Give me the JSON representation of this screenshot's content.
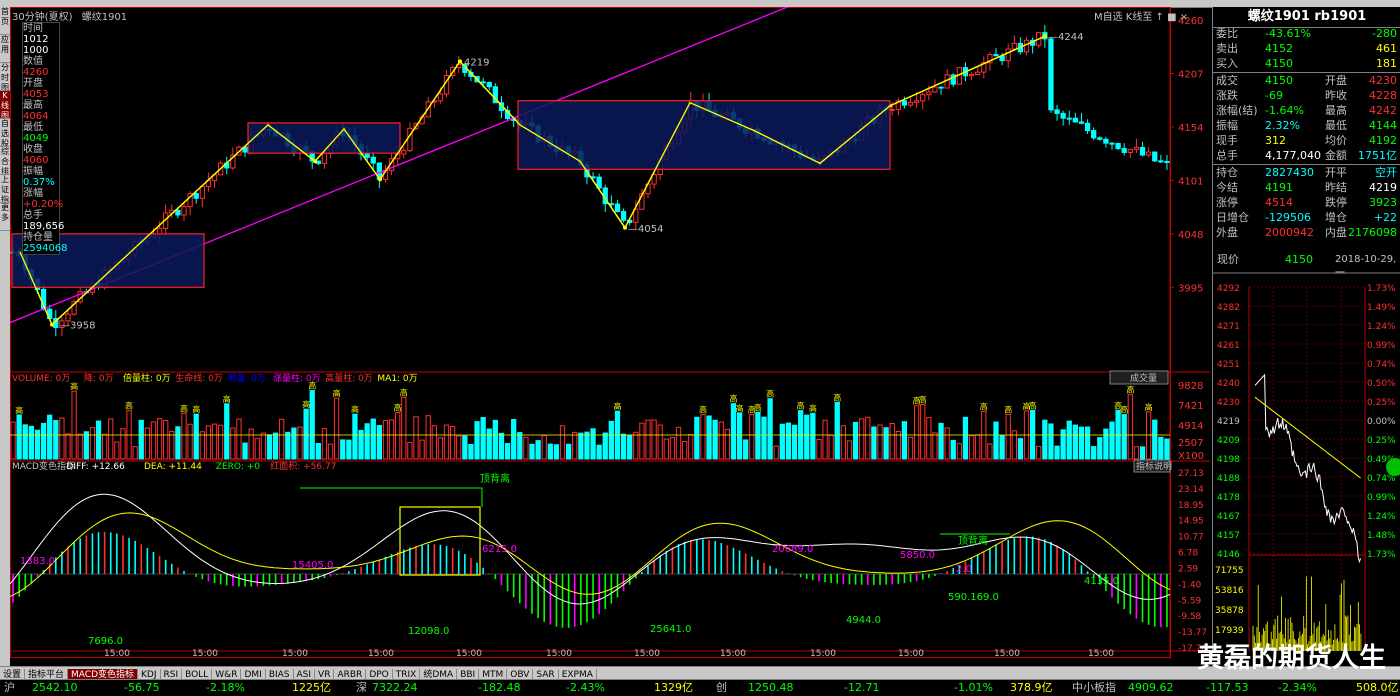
{
  "window": {
    "period_label": "30分钟(夏权)",
    "symbol_label": "螺纹1901",
    "top_tools": "M自选 K线至 ↑ ■ ×"
  },
  "left_tabs": [
    "首页",
    "应用",
    "分时图",
    "K线图",
    "自选股",
    "综合排名",
    "上证指数",
    "更多"
  ],
  "left_tab_active": 3,
  "cursor_info": [
    {
      "label": "时间",
      "color": "#c0c0c0"
    },
    {
      "label": "1012",
      "color": "#ffffff"
    },
    {
      "label": "1000",
      "color": "#ffffff"
    },
    {
      "label": "数值",
      "color": "#c0c0c0"
    },
    {
      "label": "4260",
      "color": "#ff3030"
    },
    {
      "label": "开盘",
      "color": "#c0c0c0"
    },
    {
      "label": "4053",
      "color": "#ff3030"
    },
    {
      "label": "最高",
      "color": "#c0c0c0"
    },
    {
      "label": "4064",
      "color": "#ff3030"
    },
    {
      "label": "最低",
      "color": "#c0c0c0"
    },
    {
      "label": "4049",
      "color": "#00ff00"
    },
    {
      "label": "收盘",
      "color": "#c0c0c0"
    },
    {
      "label": "4060",
      "color": "#ff3030"
    },
    {
      "label": "振幅",
      "color": "#c0c0c0"
    },
    {
      "label": "0.37%",
      "color": "#00ffff"
    },
    {
      "label": "涨幅",
      "color": "#c0c0c0"
    },
    {
      "label": "+0.20%",
      "color": "#ff3030"
    },
    {
      "label": "总手",
      "color": "#c0c0c0"
    },
    {
      "label": "189,656",
      "color": "#ffffff"
    },
    {
      "label": "持仓量",
      "color": "#c0c0c0"
    },
    {
      "label": "2594068",
      "color": "#00ffff"
    }
  ],
  "price_axis": {
    "ticks": [
      "4260",
      "4207",
      "4154",
      "4101",
      "4048",
      "3995"
    ],
    "values": [
      4260,
      4207,
      4154,
      4101,
      4048,
      3995
    ]
  },
  "annotations": {
    "high1": "4219",
    "low1": "3958",
    "low2": "4054",
    "high2": "4244"
  },
  "volume_panel": {
    "legend": [
      {
        "text": "VOLUME: 0万",
        "color": "#ff3030"
      },
      {
        "text": "降: 0万",
        "color": "#ff3030"
      },
      {
        "text": "倍量柱: 0万",
        "color": "#ffff00"
      },
      {
        "text": "生命线: 0万",
        "color": "#ff3030"
      },
      {
        "text": "地量: 0万",
        "color": "#0000ff"
      },
      {
        "text": "涨量柱: 0万",
        "color": "#ff00ff"
      },
      {
        "text": "高量柱: 0万",
        "color": "#ff3030"
      },
      {
        "text": "MA1: 0万",
        "color": "#ffff00"
      }
    ],
    "button": "成交量",
    "ticks": [
      "9828",
      "7421",
      "4914",
      "2507",
      "X100"
    ],
    "high_marker": "高"
  },
  "macd_panel": {
    "legend": [
      {
        "text": "MACD变色指标",
        "color": "#c0c0c0"
      },
      {
        "text": "DIFF: +12.66",
        "color": "#ffffff"
      },
      {
        "text": "DEA: +11.44",
        "color": "#ffff00"
      },
      {
        "text": "ZERO: +0",
        "color": "#00ff00"
      },
      {
        "text": "红面积: +56.77",
        "color": "#ff3030"
      }
    ],
    "button": "指标说明",
    "ticks": [
      "27.13",
      "23.14",
      "18.95",
      "14.95",
      "10.77",
      "6.78",
      "2.59",
      "-1.40",
      "-5.59",
      "-9.58",
      "-13.77",
      "-17.76"
    ],
    "labels": [
      {
        "t": "1383.0",
        "c": "#ff00ff"
      },
      {
        "t": "15405.0",
        "c": "#ff00ff"
      },
      {
        "t": "6215.0",
        "c": "#ff00ff"
      },
      {
        "t": "20689.0",
        "c": "#ff00ff"
      },
      {
        "t": "5850.0",
        "c": "#ff00ff"
      },
      {
        "t": "2.0",
        "c": "#ff00ff"
      },
      {
        "t": "7696.0",
        "c": "#00ff00"
      },
      {
        "t": "12098.0",
        "c": "#00ff00"
      },
      {
        "t": "25641.0",
        "c": "#00ff00"
      },
      {
        "t": "4944.0",
        "c": "#00ff00"
      },
      {
        "t": "590.169.0",
        "c": "#00ff00"
      },
      {
        "t": "4135.0",
        "c": "#00ff00"
      },
      {
        "t": "顶背离",
        "c": "#00ff00"
      },
      {
        "t": "顶背离",
        "c": "#00ff00"
      }
    ]
  },
  "time_labels": [
    "15:00",
    "15:00",
    "15:00",
    "15:00",
    "15:00",
    "15:00",
    "15:00",
    "15:00",
    "15:00",
    "15:00",
    "15:00",
    "15:00"
  ],
  "bottom_tabs": [
    "设置",
    "指标平台",
    "MACD变色指标",
    "KDJ",
    "RSI",
    "BOLL",
    "W&R",
    "DMI",
    "BIAS",
    "ASI",
    "VR",
    "ARBR",
    "DPO",
    "TRIX",
    "统DMA",
    "BBI",
    "MTM",
    "OBV",
    "SAR",
    "EXPMA"
  ],
  "bottom_tab_active": 2,
  "status_bar": [
    {
      "t": "沪",
      "c": "#c0c0c0"
    },
    {
      "t": "2542.10",
      "c": "#00ff00"
    },
    {
      "t": "-56.75",
      "c": "#00ff00"
    },
    {
      "t": "-2.18%",
      "c": "#00ff00"
    },
    {
      "t": "1225亿",
      "c": "#ffff00"
    },
    {
      "t": "深",
      "c": "#c0c0c0"
    },
    {
      "t": "7322.24",
      "c": "#00ff00"
    },
    {
      "t": "-182.48",
      "c": "#00ff00"
    },
    {
      "t": "-2.43%",
      "c": "#00ff00"
    },
    {
      "t": "1329亿",
      "c": "#ffff00"
    },
    {
      "t": "创",
      "c": "#c0c0c0"
    },
    {
      "t": "1250.48",
      "c": "#00ff00"
    },
    {
      "t": "-12.71",
      "c": "#00ff00"
    },
    {
      "t": "-1.01%",
      "c": "#00ff00"
    },
    {
      "t": "378.9亿",
      "c": "#ffff00"
    },
    {
      "t": "中小板指",
      "c": "#c0c0c0"
    },
    {
      "t": "4909.62",
      "c": "#00ff00"
    },
    {
      "t": "-117.53",
      "c": "#00ff00"
    },
    {
      "t": "-2.34%",
      "c": "#00ff00"
    },
    {
      "t": "508.0亿",
      "c": "#ffff00"
    }
  ],
  "watermark": "黄磊的期货人生",
  "quote": {
    "title": "螺纹1901 rb1901",
    "rows": [
      {
        "l": "委比",
        "v1": "-43.61%",
        "c1": "#00ff00",
        "v2": "-280",
        "c2": "#00ff00"
      },
      {
        "l": "卖出",
        "v1": "4152",
        "c1": "#00ff00",
        "v2": "461",
        "c2": "#ffff00"
      },
      {
        "l": "买入",
        "v1": "4150",
        "c1": "#00ff00",
        "v2": "181",
        "c2": "#ffff00"
      },
      {
        "l": "成交",
        "v1": "4150",
        "c1": "#00ff00",
        "l2": "开盘",
        "v2": "4230",
        "c2": "#ff3030"
      },
      {
        "l": "涨跌",
        "v1": "-69",
        "c1": "#00ff00",
        "l2": "昨收",
        "v2": "4228",
        "c2": "#ff3030"
      },
      {
        "l": "涨幅(结)",
        "v1": "-1.64%",
        "c1": "#00ff00",
        "l2": "最高",
        "v2": "4242",
        "c2": "#ff3030"
      },
      {
        "l": "振幅",
        "v1": "2.32%",
        "c1": "#00ffff",
        "l2": "最低",
        "v2": "4144",
        "c2": "#00ff00"
      },
      {
        "l": "现手",
        "v1": "312",
        "c1": "#ffff00",
        "l2": "均价",
        "v2": "4192",
        "c2": "#00ff00"
      },
      {
        "l": "总手",
        "v1": "4,177,040",
        "c1": "#ffffff",
        "l2": "金额",
        "v2": "1751亿",
        "c2": "#00ffff"
      },
      {
        "l": "持仓",
        "v1": "2827430",
        "c1": "#00ffff",
        "l2": "开平",
        "v2": "空开",
        "c2": "#00ffff"
      },
      {
        "l": "今结",
        "v1": "4191",
        "c1": "#00ff00",
        "l2": "昨结",
        "v2": "4219",
        "c2": "#ffffff"
      },
      {
        "l": "涨停",
        "v1": "4514",
        "c1": "#ff3030",
        "l2": "跌停",
        "v2": "3923",
        "c2": "#00ff00"
      },
      {
        "l": "日增仓",
        "v1": "-129506",
        "c1": "#00ffff",
        "l2": "增仓",
        "v2": "+22",
        "c2": "#00ffff"
      },
      {
        "l": "外盘",
        "v1": "2000942",
        "c1": "#ff3030",
        "l2": "内盘",
        "v2": "2176098",
        "c2": "#00ff00"
      }
    ],
    "now_label": "现价",
    "now_value": "4150",
    "now_date": "2018-10-29,一"
  },
  "minute_chart": {
    "price_ticks": [
      "4292",
      "4282",
      "4271",
      "4261",
      "4251",
      "4240",
      "4230",
      "4219",
      "4209",
      "4198",
      "4188",
      "4178",
      "4167",
      "4157",
      "4146"
    ],
    "pct_ticks": [
      "1.73%",
      "1.49%",
      "1.24%",
      "0.99%",
      "0.74%",
      "0.50%",
      "0.25%",
      "0.00%",
      "0.25%",
      "0.49%",
      "0.74%",
      "0.99%",
      "1.24%",
      "1.48%",
      "1.73%"
    ],
    "vol_ticks": [
      "71755",
      "53816",
      "35878",
      "17939"
    ]
  },
  "chart_data": {
    "type": "line",
    "title": "螺纹1901",
    "zigzag": [
      {
        "label": "3958",
        "value": 3958
      },
      {
        "label": "4219",
        "value": 4219
      },
      {
        "label": "4054",
        "value": 4054
      },
      {
        "label": "4244",
        "value": 4244
      }
    ],
    "last_price": 4150,
    "ylim": [
      3958,
      4260
    ]
  }
}
